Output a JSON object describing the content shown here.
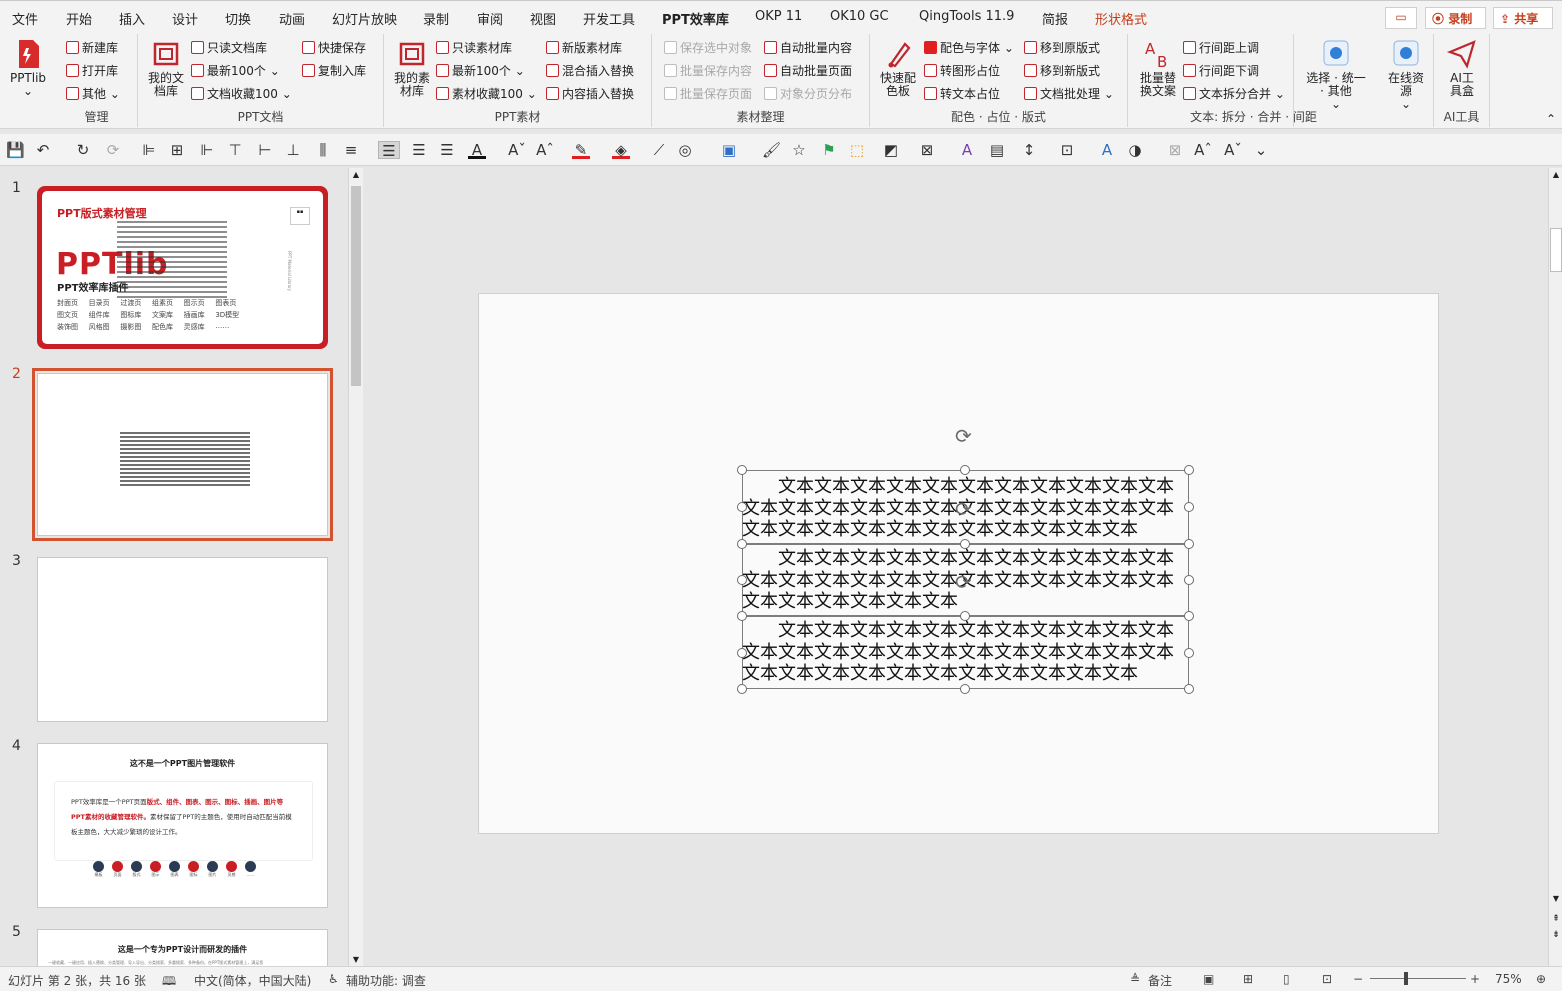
{
  "menu": {
    "tabs": [
      "文件",
      "开始",
      "插入",
      "设计",
      "切换",
      "动画",
      "幻灯片放映",
      "录制",
      "审阅",
      "视图",
      "开发工具",
      "PPT效率库",
      "OKP 11",
      "OK10 GC",
      "QingTools 11.9",
      "简报",
      "形状格式"
    ],
    "record_label": "录制",
    "share_label": "共享"
  },
  "ribbon": {
    "pptlib_label": "PPTlib",
    "groups": {
      "manage": {
        "label": "管理",
        "items": [
          "新建库",
          "打开库",
          "其他"
        ]
      },
      "ppt_doc": {
        "label": "PPT文档",
        "big_label": "我的文档库",
        "items": [
          "只读文档库",
          "最新100个",
          "文档收藏100",
          "快捷保存",
          "复制入库"
        ]
      },
      "ppt_material": {
        "label": "PPT素材",
        "big_label": "我的素材库",
        "items": [
          "只读素材库",
          "最新100个",
          "素材收藏100",
          "新版素材库",
          "混合插入替换",
          "内容插入替换"
        ]
      },
      "material_org": {
        "label": "素材整理",
        "items": [
          "保存选中对象",
          "批量保存内容",
          "批量保存页面",
          "自动批量内容",
          "自动批量页面",
          "对象分页分布"
        ]
      },
      "color": {
        "label": "配色 · 占位 · 版式",
        "big_label": "快速配色板",
        "items": [
          "配色与字体",
          "转图形占位",
          "转文本占位",
          "移到原版式",
          "移到新版式",
          "文档批处理"
        ]
      },
      "text": {
        "label": "文本: 拆分 · 合并 · 间距",
        "big_label": "批量替换文案",
        "items": [
          "行间距上调",
          "行间距下调",
          "文本拆分合并"
        ]
      },
      "select": {
        "big_label": "选择 · 统一 · 其他"
      },
      "online": {
        "big_label": "在线资源"
      },
      "ai": {
        "label": "AI工具",
        "big_label": "AI工具盒"
      }
    }
  },
  "thumbs": {
    "numbers": [
      "1",
      "2",
      "3",
      "4",
      "5"
    ],
    "slide1": {
      "title": "PPT版式素材管理",
      "brand": "PPTlib",
      "subtitle": "PPT效率库插件",
      "side": "PPT Material Library",
      "grid": [
        "封面页",
        "目录页",
        "过渡页",
        "组素页",
        "图示页",
        "图表页",
        "图文页",
        "组件库",
        "图标库",
        "文案库",
        "插画库",
        "3D模型",
        "装饰图",
        "风格图",
        "摄影图",
        "配色库",
        "灵感库",
        "……"
      ]
    },
    "slide4": {
      "title": "这不是一个PPT图片管理软件",
      "body_1": "PPT效率库是一个PPT页面",
      "body_2": "版式、组件、图表、图示、图标、插画、图片等PPT素材的收藏管理软件。",
      "body_3": "素材保留了PPT的主题色，使用时自动匹配当前模板主题色，大大减少繁琐的设计工作。",
      "icons": [
        "模板",
        "页面",
        "版式",
        "图示",
        "图表",
        "图标",
        "图片",
        "灵感",
        "……"
      ]
    },
    "slide5": {
      "title": "这是一个专为PPT设计而研发的插件",
      "body": "一键收藏、一键应用、插入替换、分类管理、导入导出、分类搜索、多重搜索、多种备份。在PPT版式素材管理上，满足您"
    }
  },
  "slide": {
    "paragraphs": [
      "文本文本文本文本文本文本文本文本文本文本文本文本文本文本文本文本文本文本文本文本文本文本文本文本文本文本文本文本文本文本文本文本文本文本",
      "文本文本文本文本文本文本文本文本文本文本文本文本文本文本文本文本文本文本文本文本文本文本文本文本文本文本文本文本文本",
      "文本文本文本文本文本文本文本文本文本文本文本文本文本文本文本文本文本文本文本文本文本文本文本文本文本文本文本文本文本文本文本文本文本文本"
    ]
  },
  "status": {
    "slide_info": "幻灯片 第 2 张，共 16 张",
    "language": "中文(简体，中国大陆)",
    "accessibility": "辅助功能: 调查",
    "notes": "备注",
    "zoom": "75%"
  }
}
